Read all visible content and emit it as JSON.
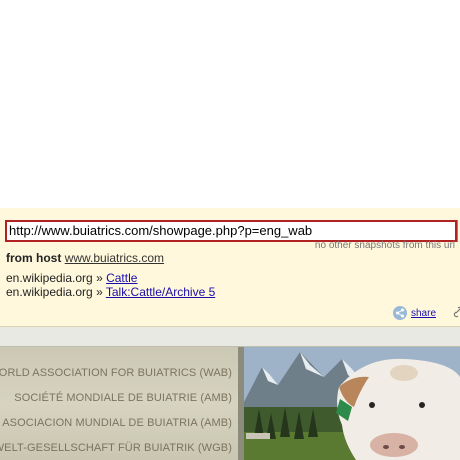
{
  "toolbar": {
    "url_value": "http://www.buiatrics.com/showpage.php?p=eng_wab",
    "snapshot_note": "no other snapshots from this url",
    "host_label": "from host",
    "host_link": "www.buiatrics.com",
    "refs": [
      {
        "domain": "en.wikipedia.org",
        "sep": "»",
        "link": "Cattle"
      },
      {
        "domain": "en.wikipedia.org",
        "sep": "»",
        "link": "Talk:Cattle/Archive 5"
      }
    ],
    "share_label": "share",
    "share_icon": "share-icon",
    "link_icon": "link-icon"
  },
  "banner": {
    "lines": [
      "WORLD ASSOCIATION FOR BUIATRICS (WAB)",
      "SOCIÉTÉ MONDIALE DE BUIATRIE (AMB)",
      "ASOCIACION MUNDIAL DE BUIATRIA (AMB)",
      "WELT-GESELLSCHAFT FÜR BUIATRIK (WGB)"
    ]
  },
  "colors": {
    "toolbar_bg": "#fff8dc",
    "url_border": "#b22222",
    "link": "#1a0dab",
    "banner_text": "#7a745f"
  }
}
